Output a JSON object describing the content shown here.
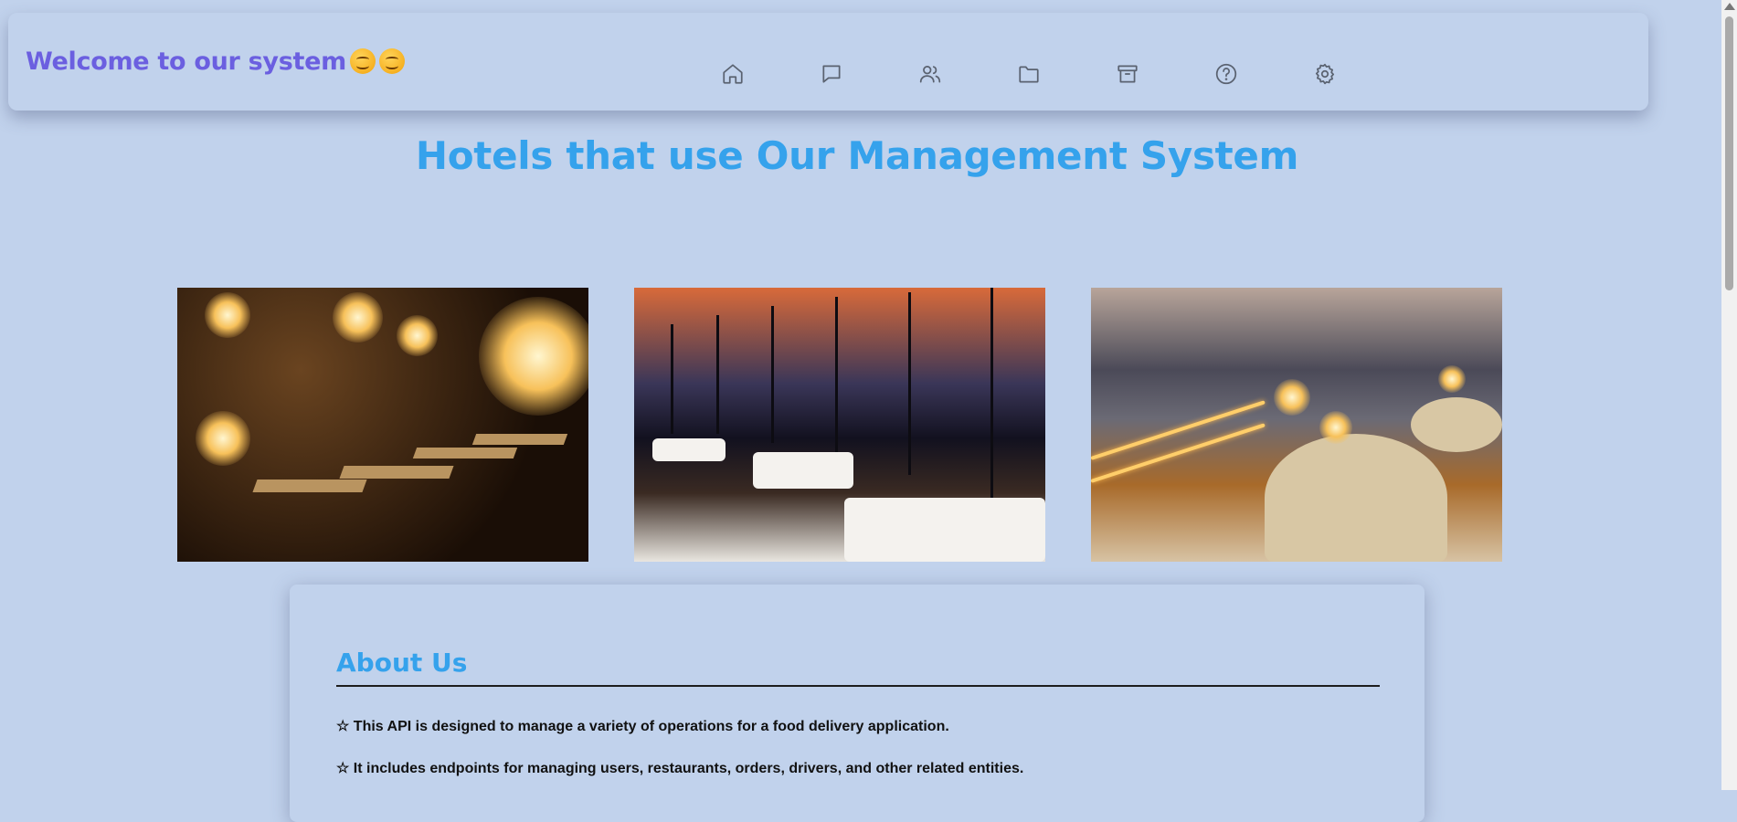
{
  "header": {
    "welcome_text": "Welcome to our system",
    "emojis": [
      "smiling-face-emoji",
      "smiling-face-emoji"
    ],
    "nav_icons": [
      "home-icon",
      "message-icon",
      "users-icon",
      "folder-icon",
      "archive-icon",
      "help-icon",
      "settings-icon"
    ]
  },
  "main": {
    "title": "Hotels that use Our Management System",
    "photos": [
      "restaurant-interior-photo",
      "panoramic-restaurant-photo",
      "seaside-dining-photo"
    ]
  },
  "about": {
    "heading": "About Us",
    "items": [
      "☆ This API is designed to manage a variety of operations for a food delivery application.",
      "☆ It includes endpoints for managing users, restaurants, orders, drivers, and other related entities."
    ]
  },
  "colors": {
    "background": "#c1d2ec",
    "welcome_text": "#6b5fe0",
    "accent_blue": "#35a2ec"
  }
}
